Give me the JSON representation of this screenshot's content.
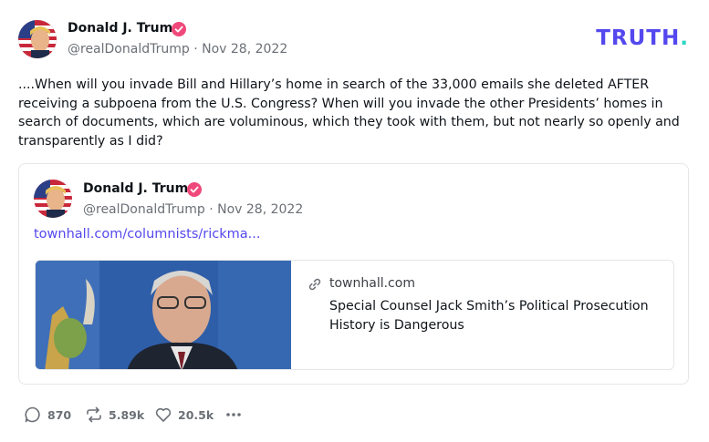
{
  "post": {
    "author_name": "Donald J. Trump",
    "handle_date": "@realDonaldTrump · Nov 28, 2022",
    "body": "....When will you invade Bill and Hillary’s home in search of the 33,000 emails she deleted AFTER receiving a subpoena from the U.S. Congress? When will you invade the other Presidents’ homes in search of documents, which are voluminous, which they took with them, but not nearly so openly and transparently as I did?"
  },
  "brand": {
    "wordmark": "TRUTH",
    "dot": "."
  },
  "quote": {
    "author_name": "Donald J. Trump",
    "handle_date": "@realDonaldTrump · Nov 28, 2022",
    "link_text": "townhall.com/columnists/rickma...",
    "card": {
      "domain": "townhall.com",
      "title": "Special Counsel Jack Smith’s Political Prosecution History is Dangerous"
    }
  },
  "actions": {
    "replies": "870",
    "retruths": "5.89k",
    "likes": "20.5k"
  },
  "colors": {
    "brand": "#5448ee",
    "verified": "#f0487a",
    "accent_teal": "#2ad7c5"
  },
  "icons": [
    "verified-badge-icon",
    "link-icon",
    "reply-icon",
    "retruth-icon",
    "like-icon",
    "more-icon"
  ]
}
